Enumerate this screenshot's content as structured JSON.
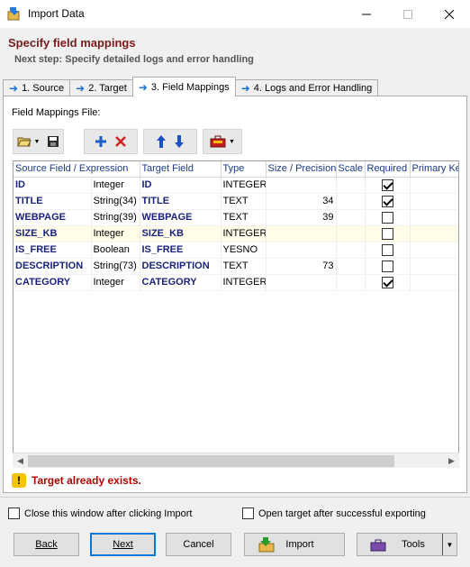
{
  "window": {
    "title": "Import Data"
  },
  "header": {
    "title": "Specify field mappings",
    "subtitle": "Next step: Specify detailed logs and error handling"
  },
  "tabs": [
    {
      "label": "1. Source"
    },
    {
      "label": "2. Target"
    },
    {
      "label": "3. Field Mappings",
      "active": true
    },
    {
      "label": "4. Logs and Error Handling"
    }
  ],
  "mappings_file_label": "Field Mappings File:",
  "grid": {
    "columns": [
      "Source Field / Expression",
      "",
      "Target Field",
      "Type",
      "Size / Precision",
      "Scale",
      "Required",
      "Primary Key"
    ],
    "rows": [
      {
        "source": "ID",
        "src_type": "Integer",
        "target": "ID",
        "type": "INTEGER",
        "size": "",
        "scale": "",
        "required": true,
        "pk": true
      },
      {
        "source": "TITLE",
        "src_type": "String(34)",
        "target": "TITLE",
        "type": "TEXT",
        "size": "34",
        "scale": "",
        "required": true,
        "pk": false
      },
      {
        "source": "WEBPAGE",
        "src_type": "String(39)",
        "target": "WEBPAGE",
        "type": "TEXT",
        "size": "39",
        "scale": "",
        "required": false,
        "pk": false
      },
      {
        "source": "SIZE_KB",
        "src_type": "Integer",
        "target": "SIZE_KB",
        "type": "INTEGER",
        "size": "",
        "scale": "",
        "required": false,
        "pk": false
      },
      {
        "source": "IS_FREE",
        "src_type": "Boolean",
        "target": "IS_FREE",
        "type": "YESNO",
        "size": "",
        "scale": "",
        "required": false,
        "pk": false
      },
      {
        "source": "DESCRIPTION",
        "src_type": "String(73)",
        "target": "DESCRIPTION",
        "type": "TEXT",
        "size": "73",
        "scale": "",
        "required": false,
        "pk": false
      },
      {
        "source": "CATEGORY",
        "src_type": "Integer",
        "target": "CATEGORY",
        "type": "INTEGER",
        "size": "",
        "scale": "",
        "required": true,
        "pk": false
      }
    ]
  },
  "warning": "Target already exists.",
  "options": {
    "close_after": "Close this window after clicking Import",
    "open_target": "Open target after successful exporting"
  },
  "buttons": {
    "back": "Back",
    "next": "Next",
    "cancel": "Cancel",
    "import": "Import",
    "tools": "Tools"
  },
  "colors": {
    "header_title": "#7a1a1a",
    "field_name": "#1a237e",
    "accent": "#0078d7",
    "warning": "#b00000"
  }
}
